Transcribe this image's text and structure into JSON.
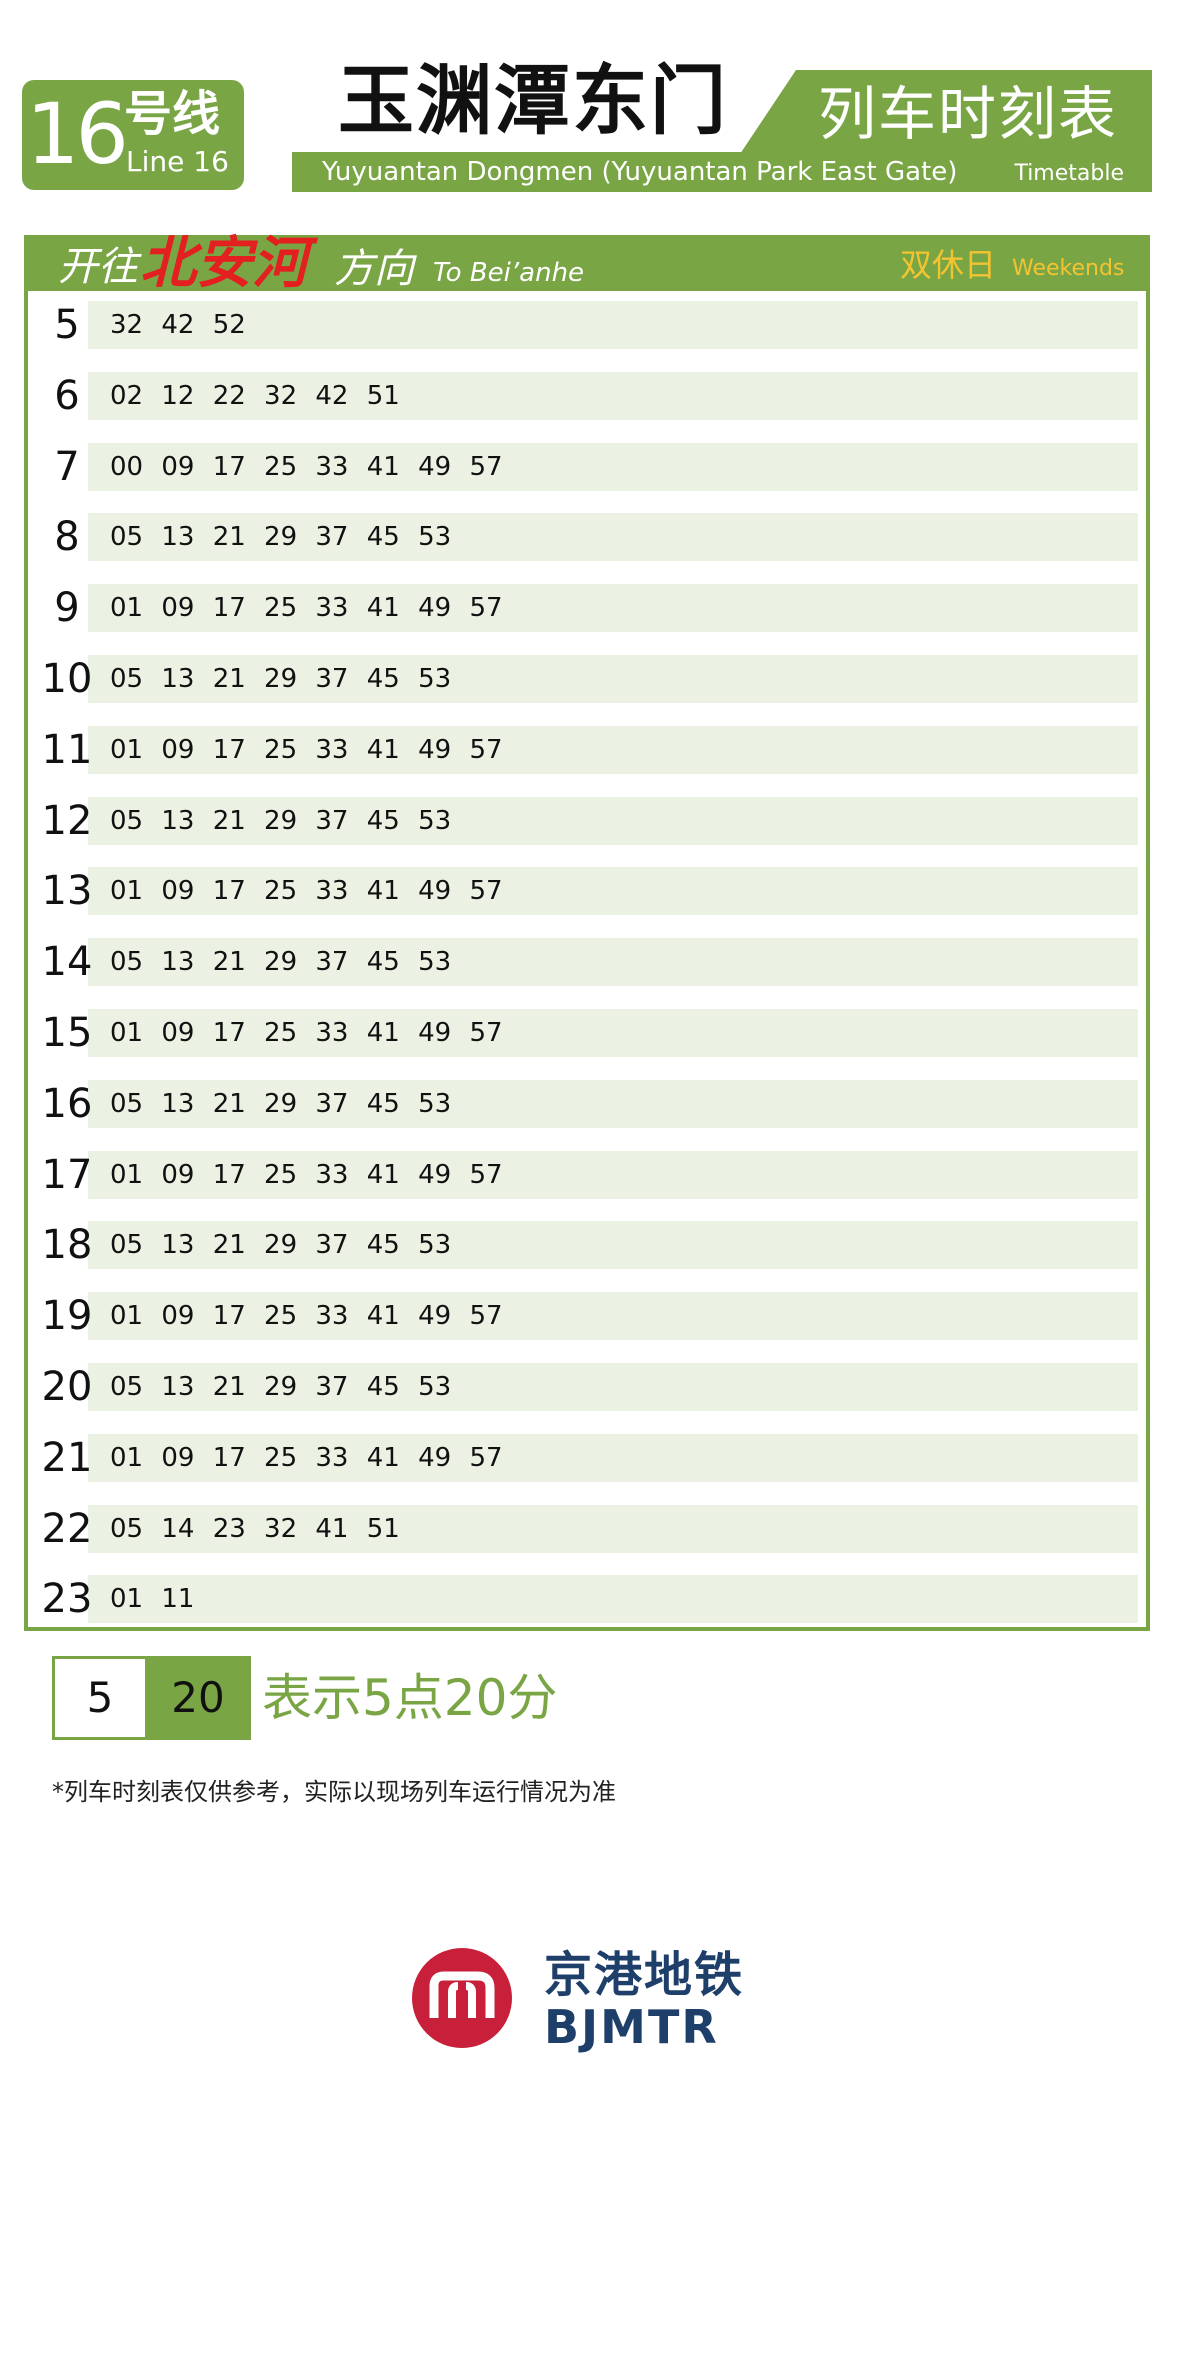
{
  "header": {
    "line_number": "16",
    "line_cn": "号线",
    "line_en": "Line 16",
    "station_cn": "玉渊潭东门",
    "station_en": "Yuyuantan Dongmen (Yuyuantan Park East Gate)",
    "timetable_cn": "列车时刻表",
    "timetable_en": "Timetable"
  },
  "direction": {
    "prefix_cn": "开往",
    "destination_cn": "北安河",
    "suffix_cn": "方向",
    "destination_en": "To Bei’anhe",
    "schedule_cn": "双休日",
    "schedule_en": "Weekends"
  },
  "timetable": [
    {
      "hour": "5",
      "minutes": "32 42 52"
    },
    {
      "hour": "6",
      "minutes": "02 12 22 32 42 51"
    },
    {
      "hour": "7",
      "minutes": "00 09 17 25 33 41 49 57"
    },
    {
      "hour": "8",
      "minutes": "05 13 21 29 37 45 53"
    },
    {
      "hour": "9",
      "minutes": "01 09 17 25 33 41 49 57"
    },
    {
      "hour": "10",
      "minutes": "05 13 21 29 37 45 53"
    },
    {
      "hour": "11",
      "minutes": "01 09 17 25 33 41 49 57"
    },
    {
      "hour": "12",
      "minutes": "05 13 21 29 37 45 53"
    },
    {
      "hour": "13",
      "minutes": "01 09 17 25 33 41 49 57"
    },
    {
      "hour": "14",
      "minutes": "05 13 21 29 37 45 53"
    },
    {
      "hour": "15",
      "minutes": "01 09 17 25 33 41 49 57"
    },
    {
      "hour": "16",
      "minutes": "05 13 21 29 37 45 53"
    },
    {
      "hour": "17",
      "minutes": "01 09 17 25 33 41 49 57"
    },
    {
      "hour": "18",
      "minutes": "05 13 21 29 37 45 53"
    },
    {
      "hour": "19",
      "minutes": "01 09 17 25 33 41 49 57"
    },
    {
      "hour": "20",
      "minutes": "05 13 21 29 37 45 53"
    },
    {
      "hour": "21",
      "minutes": "01 09 17 25 33 41 49 57"
    },
    {
      "hour": "22",
      "minutes": "05 14 23 32 41 51"
    },
    {
      "hour": "23",
      "minutes": "01 11"
    }
  ],
  "legend": {
    "hour_example": "5",
    "minute_example": "20",
    "text": "表示5点20分"
  },
  "note": "*列车时刻表仅供参考，实际以现场列车运行情况为准",
  "logo": {
    "name_cn": "京港地铁",
    "name_en": "BJMTR"
  },
  "colors": {
    "accent_green": "#79a545",
    "row_bg": "#ecf2e3",
    "destination_red": "#e31f1f",
    "weekend_yellow": "#f4c430",
    "logo_red": "#c8203a",
    "logo_navy": "#1f3f6b"
  }
}
